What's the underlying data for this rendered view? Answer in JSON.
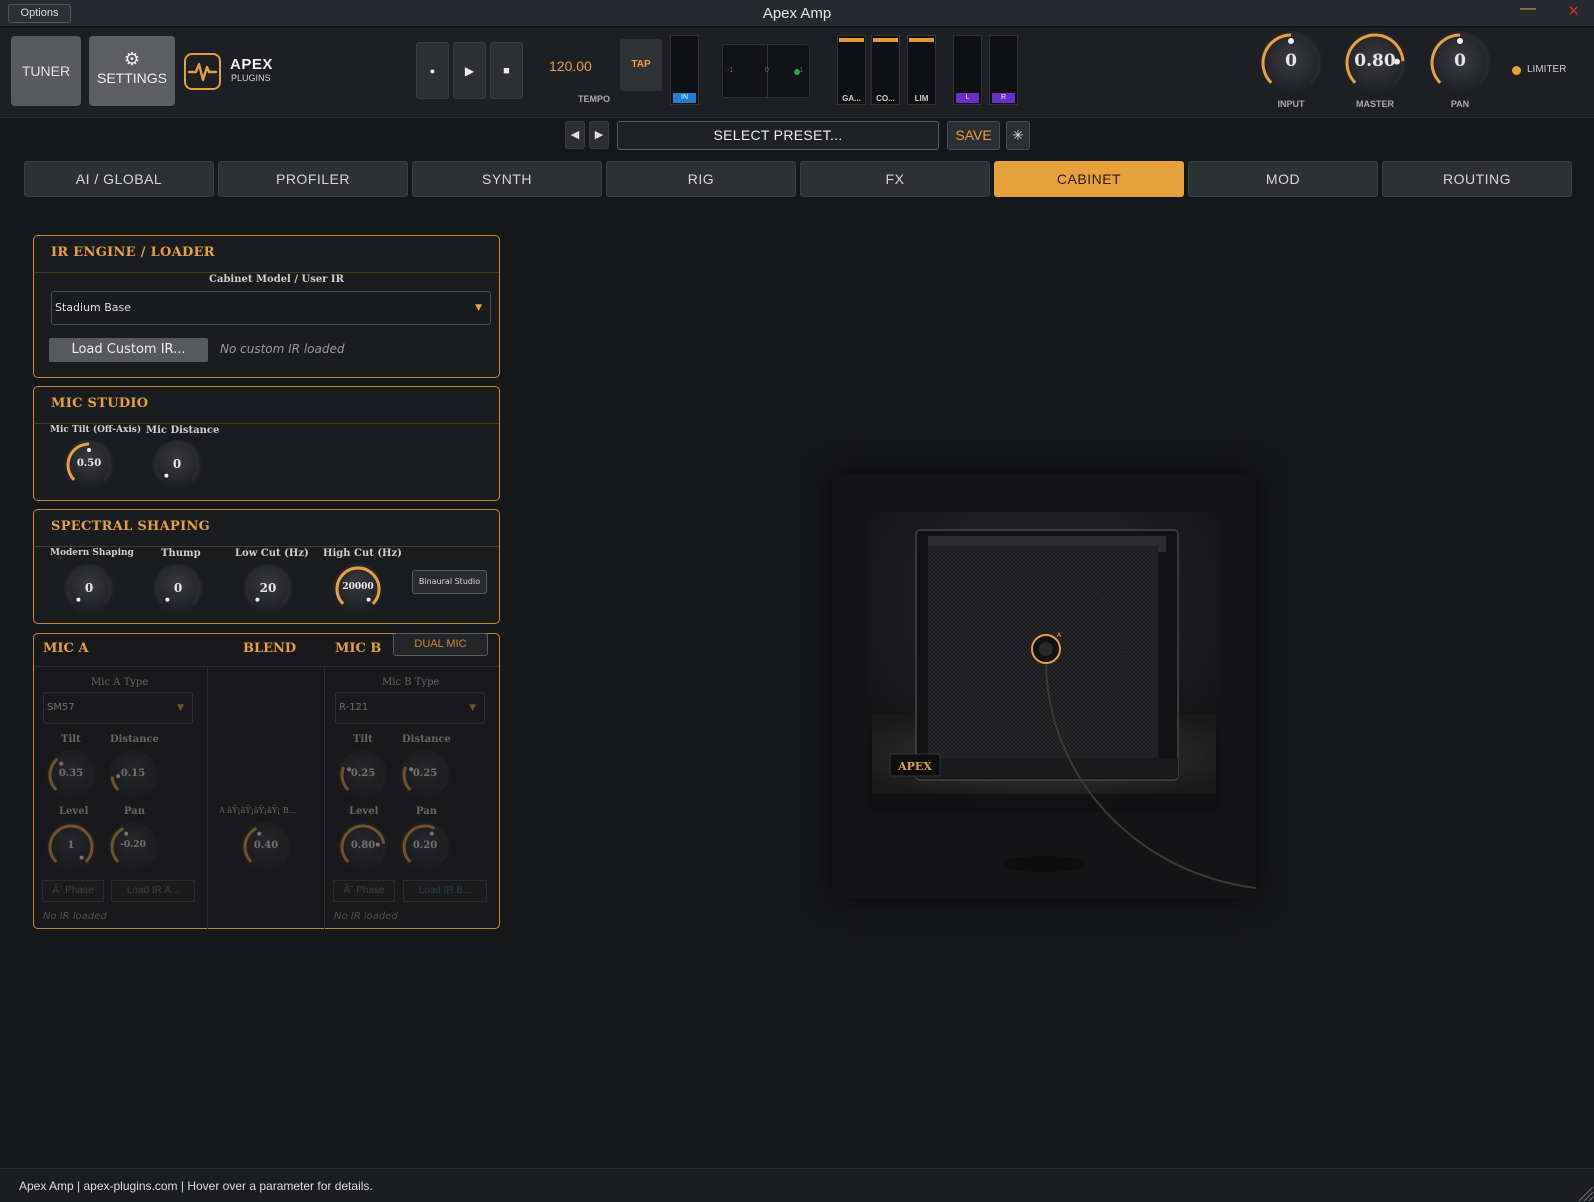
{
  "window": {
    "title": "Apex Amp",
    "options_label": "Options",
    "minimize_glyph": "—",
    "close_glyph": "✕"
  },
  "toolbar": {
    "tuner_label": "TUNER",
    "settings_label": "SETTINGS",
    "settings_icon": "gear-icon",
    "brand_name": "APEX",
    "brand_sub": "PLUGINS",
    "record_glyph": "●",
    "play_glyph": "▶",
    "stop_glyph": "■",
    "tempo_value": "120.00",
    "tempo_label": "TEMPO",
    "tap_label": "TAP",
    "in_meter_label": "IN",
    "pan_scope": {
      "left": "-1",
      "center": "0",
      "right": "+1"
    },
    "meters": [
      {
        "label": "GA..."
      },
      {
        "label": "CO..."
      },
      {
        "label": "LIM"
      }
    ],
    "out_meters": [
      {
        "label": "L"
      },
      {
        "label": "R"
      }
    ],
    "knobs": [
      {
        "label": "INPUT",
        "value": "0",
        "level": 0.5
      },
      {
        "label": "MASTER",
        "value": "0.80",
        "level": 0.82
      },
      {
        "label": "PAN",
        "value": "0",
        "level": 0.5
      }
    ],
    "limiter_label": "LIMITER",
    "accent": "#e6a13d"
  },
  "preset": {
    "prev_glyph": "◀",
    "next_glyph": "▶",
    "name": "SELECT PRESET...",
    "save_label": "SAVE",
    "extra_glyph": "✳"
  },
  "tabs": [
    {
      "label": "AI / GLOBAL",
      "active": false
    },
    {
      "label": "PROFILER",
      "active": false
    },
    {
      "label": "SYNTH",
      "active": false
    },
    {
      "label": "RIG",
      "active": false
    },
    {
      "label": "FX",
      "active": false
    },
    {
      "label": "CABINET",
      "active": true
    },
    {
      "label": "MOD",
      "active": false
    },
    {
      "label": "ROUTING",
      "active": false
    }
  ],
  "ir_engine": {
    "title": "IR ENGINE / LOADER",
    "model_label": "Cabinet Model / User IR",
    "model_value": "Stadium Base",
    "load_button": "Load Custom IR...",
    "status": "No custom IR loaded"
  },
  "mic_studio": {
    "title": "MIC STUDIO",
    "knobs": [
      {
        "label": "Mic Tilt (Off-Axis)",
        "value": "0.50"
      },
      {
        "label": "Mic Distance",
        "value": "0"
      }
    ]
  },
  "spectral": {
    "title": "SPECTRAL SHAPING",
    "knobs": [
      {
        "label": "Modern Shaping",
        "value": "0"
      },
      {
        "label": "Thump",
        "value": "0"
      },
      {
        "label": "Low Cut (Hz)",
        "value": "20"
      },
      {
        "label": "High Cut (Hz)",
        "value": "20000"
      }
    ],
    "binaural_button": "Binaural Studio"
  },
  "dual_mic": {
    "mic_a_title": "MIC A",
    "blend_title": "BLEND",
    "mic_b_title": "MIC B",
    "dual_button": "DUAL MIC",
    "mic_a": {
      "type_label": "Mic A Type",
      "type_value": "SM57",
      "tilt_label": "Tilt",
      "tilt_value": "0.35",
      "distance_label": "Distance",
      "distance_value": "0.15",
      "level_label": "Level",
      "level_value": "1",
      "pan_label": "Pan",
      "pan_value": "-0.20",
      "phase_button": "Ã˜ Phase",
      "load_button": "Load IR A...",
      "status": "No IR loaded"
    },
    "blend": {
      "label": "A ãŸ¡ãŸ¡ãŸ¡ãŸ¡ B...",
      "value": "0.40"
    },
    "mic_b": {
      "type_label": "Mic B Type",
      "type_value": "R-121",
      "tilt_label": "Tilt",
      "tilt_value": "0.25",
      "distance_label": "Distance",
      "distance_value": "0.25",
      "level_label": "Level",
      "level_value": "0.80",
      "pan_label": "Pan",
      "pan_value": "0.20",
      "phase_button": "Ã˜ Phase",
      "load_button": "Load IR B...",
      "status": "No IR loaded"
    }
  },
  "cabinet_art": {
    "badge": "APEX",
    "mic_label": "A"
  },
  "status_bar": {
    "text": "Apex Amp | apex-plugins.com | Hover over a parameter for details."
  }
}
